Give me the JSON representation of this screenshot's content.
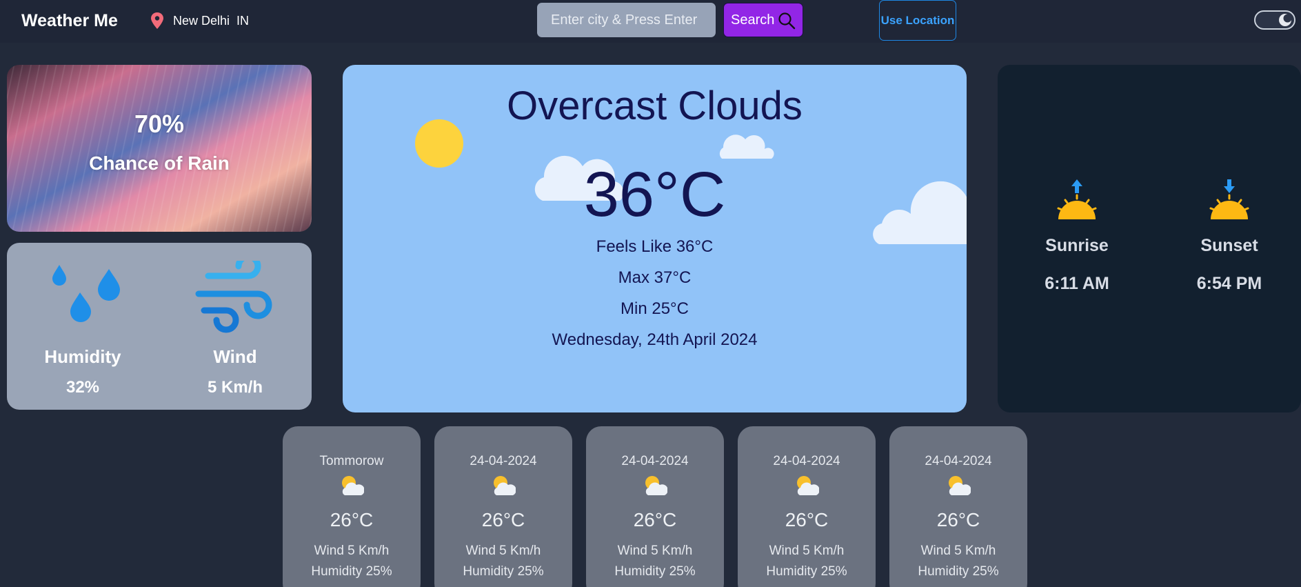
{
  "app": {
    "brand": "Weather Me"
  },
  "location": {
    "text": "New Delhi  IN"
  },
  "search": {
    "placeholder": "Enter city & Press Enter",
    "button_label": "Search"
  },
  "use_location": {
    "label": "Use Location"
  },
  "theme_toggle": {
    "state": "dark"
  },
  "rain": {
    "percent": "70%",
    "label": "Chance of Rain"
  },
  "humidity": {
    "label": "Humidity",
    "value": "32%"
  },
  "wind": {
    "label": "Wind",
    "value": "5 Km/h"
  },
  "current": {
    "condition": "Overcast Clouds",
    "temperature": "36°C",
    "feels_like": "Feels Like 36°C",
    "max": "Max 37°C",
    "min": "Min 25°C",
    "date": "Wednesday, 24th April 2024"
  },
  "sun": {
    "sunrise_label": "Sunrise",
    "sunrise_time": "6:11 AM",
    "sunset_label": "Sunset",
    "sunset_time": "6:54 PM"
  },
  "forecast": [
    {
      "day": "Tommorow",
      "icon": "sun-behind-cloud-icon",
      "temp": "26°C",
      "wind": "Wind 5 Km/h",
      "humidity": "Humidity 25%"
    },
    {
      "day": "24-04-2024",
      "icon": "sun-behind-cloud-icon",
      "temp": "26°C",
      "wind": "Wind 5 Km/h",
      "humidity": "Humidity 25%"
    },
    {
      "day": "24-04-2024",
      "icon": "sun-behind-cloud-icon",
      "temp": "26°C",
      "wind": "Wind 5 Km/h",
      "humidity": "Humidity 25%"
    },
    {
      "day": "24-04-2024",
      "icon": "sun-behind-cloud-icon",
      "temp": "26°C",
      "wind": "Wind 5 Km/h",
      "humidity": "Humidity 25%"
    },
    {
      "day": "24-04-2024",
      "icon": "sun-behind-cloud-icon",
      "temp": "26°C",
      "wind": "Wind 5 Km/h",
      "humidity": "Humidity 25%"
    }
  ],
  "colors": {
    "page_bg": "#222a3a",
    "main_card": "#91c3f8",
    "search_button": "#9226e6",
    "location_button": "#1e88e5",
    "forecast_card": "#6b7280",
    "sun_card": "#12202f"
  }
}
